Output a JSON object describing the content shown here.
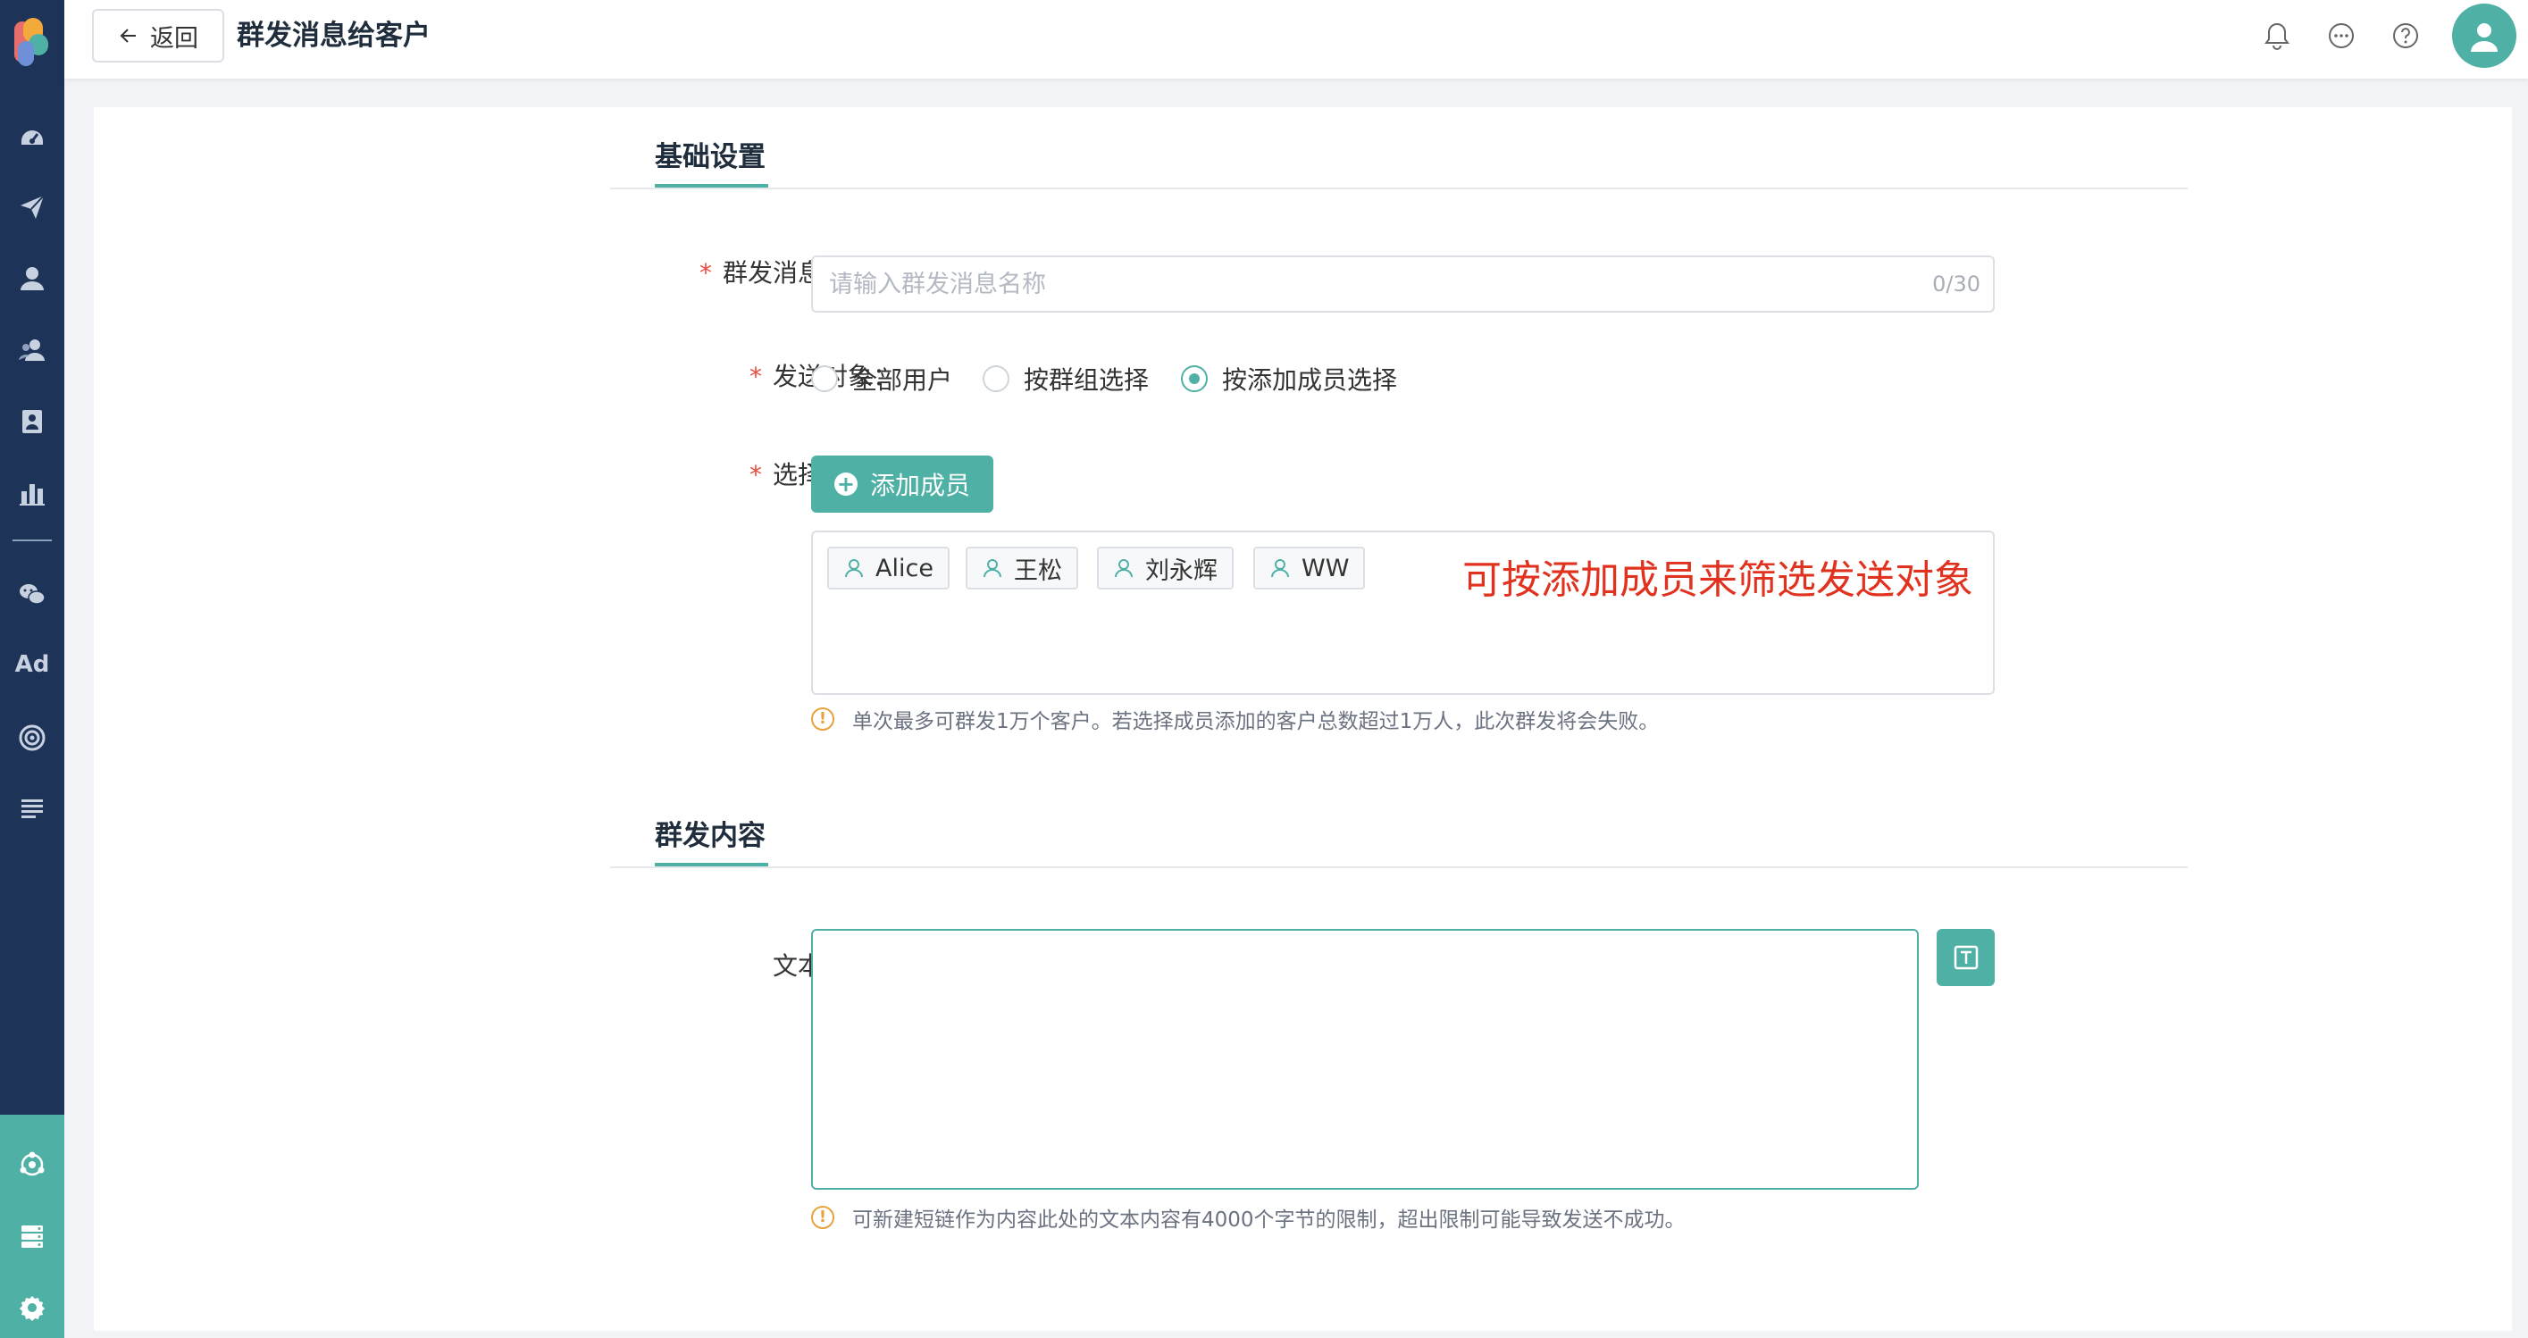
{
  "header": {
    "back_label": "返回",
    "title": "群发消息给客户",
    "icons": [
      "bell-icon",
      "chat-icon",
      "help-icon",
      "user-avatar-icon"
    ]
  },
  "sidebar": {
    "items": [
      "dashboard-icon",
      "send-icon",
      "user-icon",
      "group-users-icon",
      "badge-icon",
      "bar-chart-icon",
      "wechat-icon",
      "ad-icon",
      "target-icon",
      "list-icon"
    ],
    "ad_label": "Ad",
    "bottom_items": [
      "network-icon",
      "server-icon",
      "settings-icon"
    ]
  },
  "sections": {
    "basic": {
      "title": "基础设置"
    },
    "content": {
      "title": "群发内容"
    }
  },
  "form": {
    "name_label": "群发消息名称：",
    "name_placeholder": "请输入群发消息名称",
    "name_value": "",
    "name_counter": "0/30",
    "target_label": "发送对象：",
    "target_options": [
      "全部用户",
      "按群组选择",
      "按添加成员选择"
    ],
    "target_selected": "按添加成员选择",
    "members_label": "选择成员：",
    "add_member_label": "添加成员",
    "members": [
      "Alice",
      "王松",
      "刘永辉",
      "WW"
    ],
    "annotation": "可按添加成员来筛选发送对象",
    "members_hint": "单次最多可群发1万个客户。若选择成员添加的客户总数超过1万人，此次群发将会失败。",
    "text_label": "文本内容：",
    "text_value": "",
    "text_hint": "可新建短链作为内容此处的文本内容有4000个字节的限制，超出限制可能导致发送不成功。",
    "required_mark": "*"
  },
  "colors": {
    "accent": "#4fb0a5",
    "sidebar": "#1d3358",
    "required": "#e84c3d",
    "annotation": "#e0321e",
    "warning": "#e6a23c"
  }
}
